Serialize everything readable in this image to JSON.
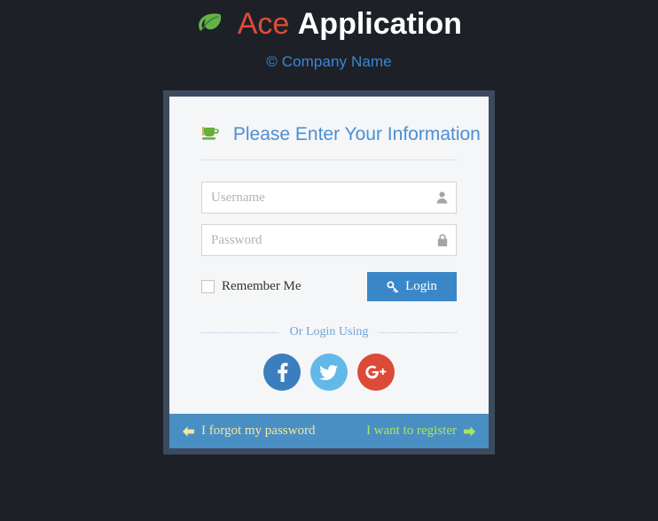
{
  "header": {
    "logo_icon": "leaf-icon",
    "brand_first": "Ace",
    "brand_second": "Application",
    "subtitle": "© Company Name",
    "brand_first_color": "#e24b36",
    "brand_second_color": "#ffffff",
    "subtitle_color": "#3a86d8",
    "leaf_color": "#62b24a"
  },
  "card": {
    "title": "Please Enter Your Information",
    "title_icon": "coffee-cup-icon",
    "title_color": "#4b8fd4",
    "frame_color": "#3c4a5e",
    "body_color": "#f5f6f7"
  },
  "form": {
    "username": {
      "value": "",
      "placeholder": "Username",
      "icon": "user-icon"
    },
    "password": {
      "value": "",
      "placeholder": "Password",
      "icon": "lock-icon"
    },
    "remember": {
      "label": "Remember Me",
      "checked": false
    },
    "login_button": {
      "label": "Login",
      "icon": "key-icon",
      "color": "#3a87c8"
    }
  },
  "divider": {
    "text": "Or Login Using"
  },
  "social": [
    {
      "name": "facebook",
      "glyph": "f",
      "color": "#3b7ebd",
      "label": "Facebook"
    },
    {
      "name": "twitter",
      "glyph": "",
      "color": "#62b8e6",
      "label": "Twitter"
    },
    {
      "name": "google-plus",
      "glyph": "g+",
      "color": "#dc4a38",
      "label": "Google Plus"
    }
  ],
  "footer": {
    "background": "#4a8fc4",
    "forgot_label": "I forgot my password",
    "forgot_color": "#f3e6a0",
    "register_label": "I want to register",
    "register_color": "#a9e566",
    "left_arrow_icon": "arrow-left-icon",
    "right_arrow_icon": "arrow-right-icon"
  },
  "page": {
    "background": "#1d2127"
  }
}
